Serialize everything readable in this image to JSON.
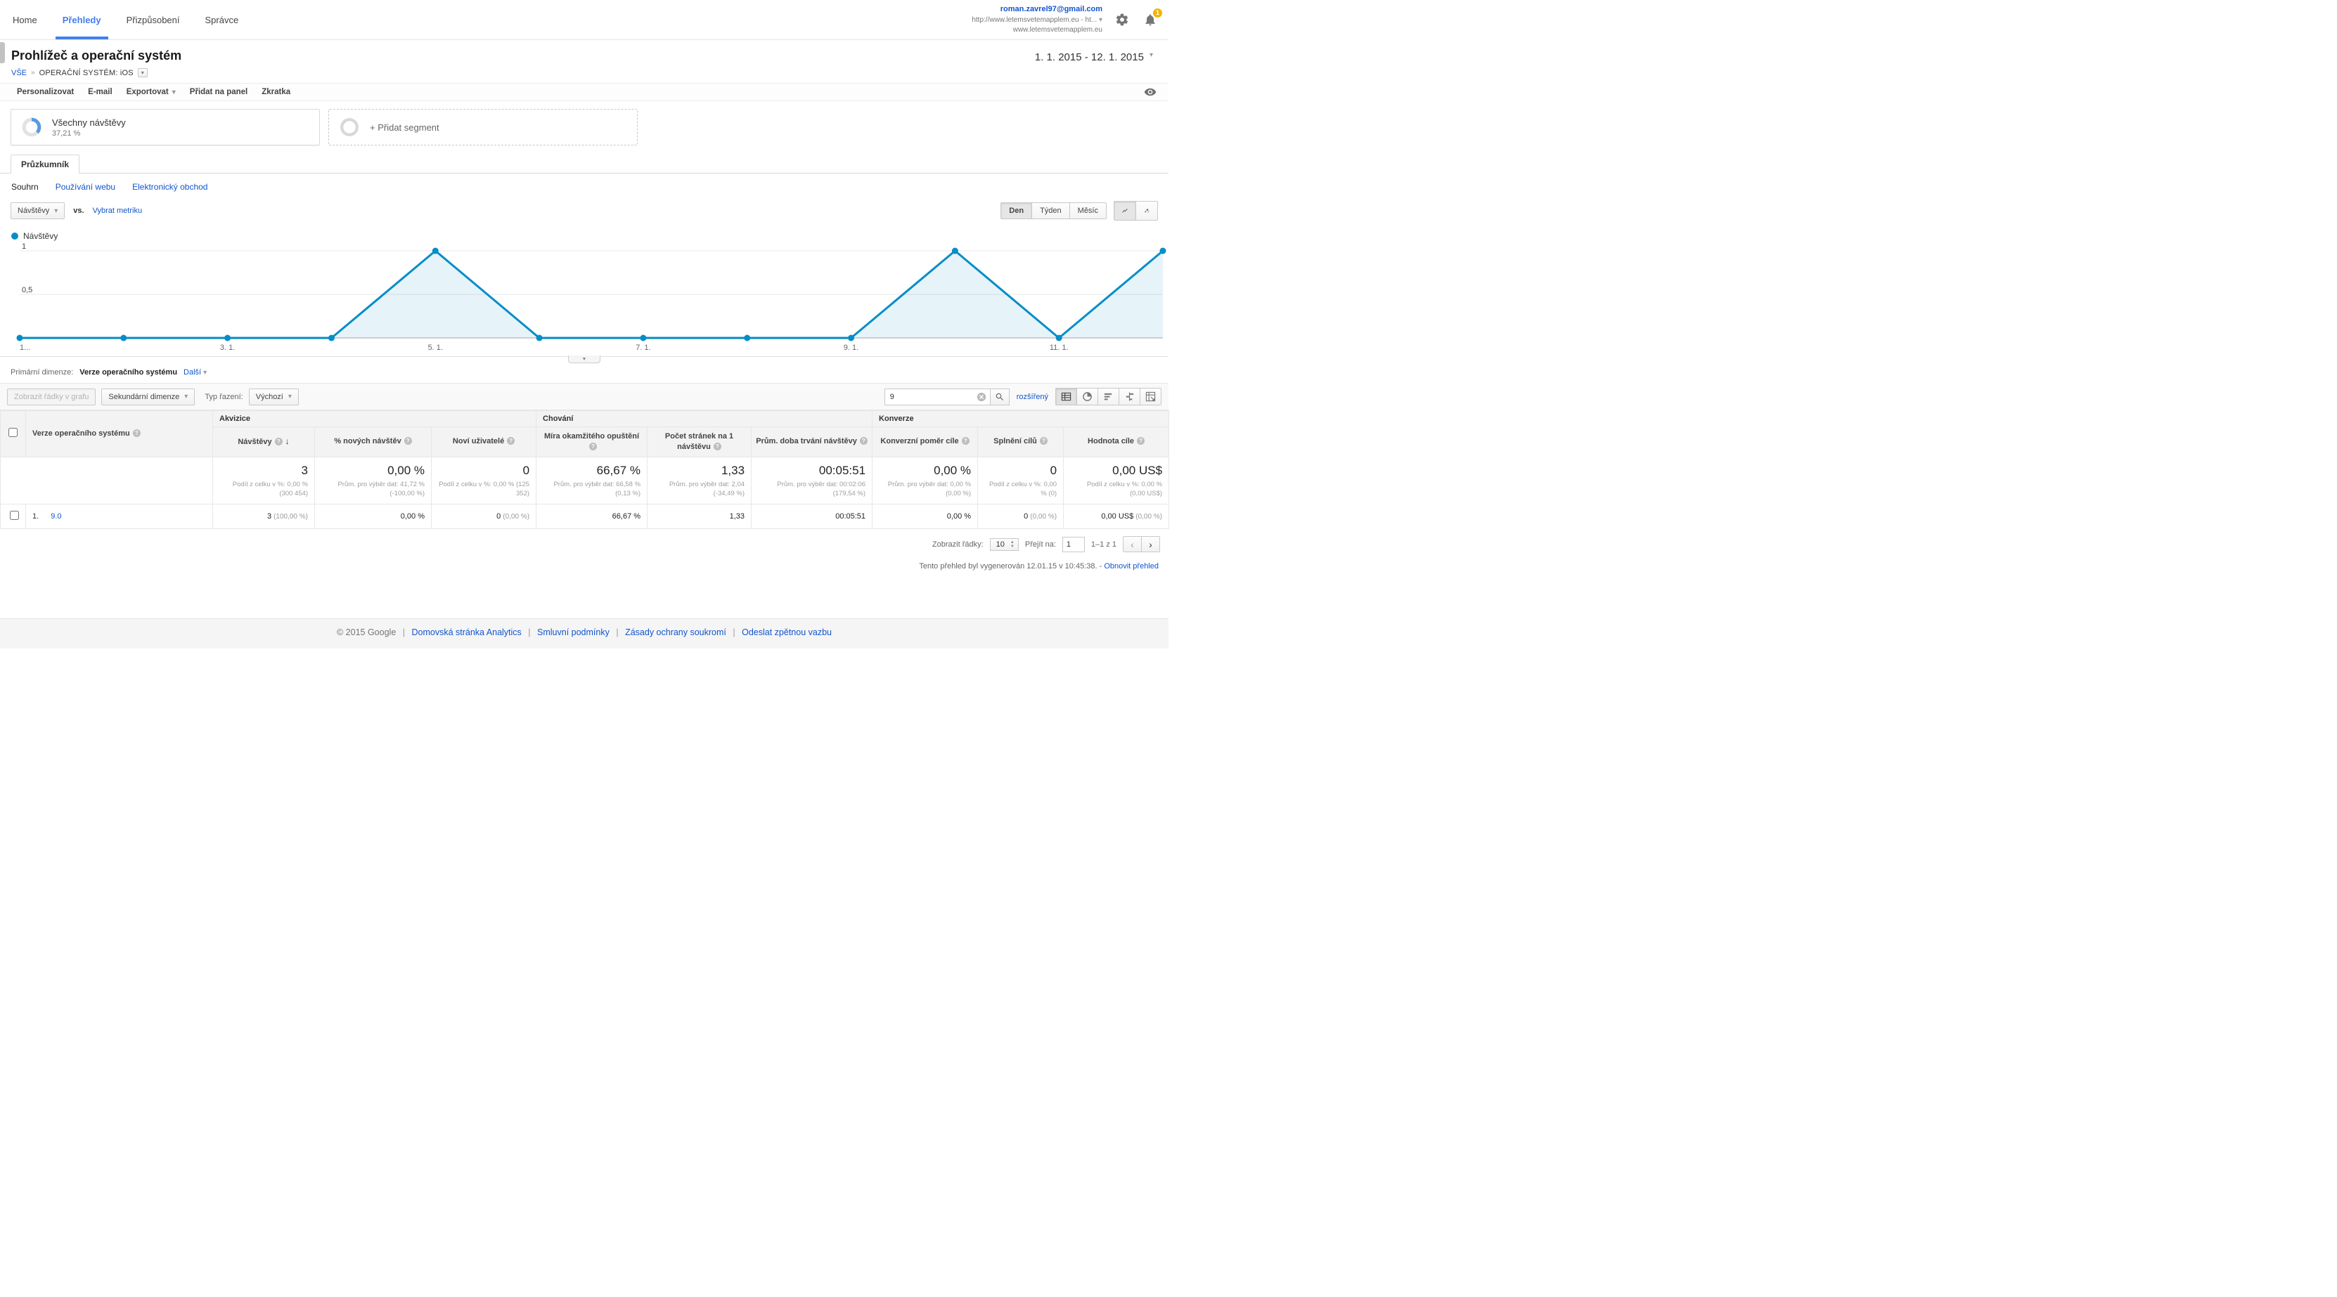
{
  "topnav": {
    "items": [
      {
        "label": "Home"
      },
      {
        "label": "Přehledy"
      },
      {
        "label": "Přizpůsobení"
      },
      {
        "label": "Správce"
      }
    ],
    "account_email": "roman.zavrel97@gmail.com",
    "account_line1": "http://www.letemsvetemapplem.eu - ht...",
    "account_line2": "www.letemsvetemapplem.eu",
    "notification_count": "1"
  },
  "header": {
    "title": "Prohlížeč a operační systém",
    "breadcrumb_all": "VŠE",
    "breadcrumb_segment": "OPERAČNÍ SYSTÉM: iOS",
    "date_range": "1. 1. 2015 - 12. 1. 2015"
  },
  "actionbar": {
    "items": [
      "Personalizovat",
      "E-mail",
      "Exportovat",
      "Přidat na panel",
      "Zkratka"
    ]
  },
  "segments": {
    "all_visits_label": "Všechny návštěvy",
    "all_visits_pct": "37,21 %",
    "add_segment": "+ Přidat segment"
  },
  "explorer": {
    "tab": "Průzkumník",
    "subtabs": [
      {
        "label": "Souhrn"
      },
      {
        "label": "Používání webu"
      },
      {
        "label": "Elektronický obchod"
      }
    ],
    "metric_select": "Návštěvy",
    "vs": "vs.",
    "select_metric": "Vybrat metriku",
    "granularity": [
      "Den",
      "Týden",
      "Měsíc"
    ],
    "legend": "Návštěvy"
  },
  "chart_data": {
    "type": "line",
    "title": "Návštěvy",
    "x": [
      "1. 1.",
      "2. 1.",
      "3. 1.",
      "4. 1.",
      "5. 1.",
      "6. 1.",
      "7. 1.",
      "8. 1.",
      "9. 1.",
      "10. 1.",
      "11. 1.",
      "12. 1."
    ],
    "series": [
      {
        "name": "Návštěvy",
        "values": [
          0,
          0,
          0,
          0,
          1,
          0,
          0,
          0,
          0,
          1,
          0,
          1
        ]
      }
    ],
    "ylim": [
      0,
      1
    ],
    "yticks": [
      "1",
      "0,5"
    ],
    "xtick_labels_visible": [
      "1...",
      "3. 1.",
      "5. 1.",
      "7. 1.",
      "9. 1.",
      "11. 1."
    ],
    "tick_positions": [
      0,
      2,
      4,
      6,
      8,
      10
    ],
    "line_color": "#058dc7",
    "fill_color": "rgba(5,141,199,0.10)",
    "grid": true,
    "legend_position": "top-left"
  },
  "dimension_bar": {
    "label": "Primární dimenze:",
    "selected": "Verze operačního systému",
    "more": "Další"
  },
  "table_toolbar": {
    "plot_rows": "Zobrazit řádky v grafu",
    "secondary_dimension": "Sekundární dimenze",
    "sort_type_label": "Typ řazení:",
    "sort_type_value": "Výchozí",
    "search_value": "9",
    "advanced": "rozšířený"
  },
  "table": {
    "groups": [
      "Akvizice",
      "Chování",
      "Konverze"
    ],
    "dimension_header": "Verze operačního systému",
    "columns": [
      "Návštěvy",
      "% nových návštěv",
      "Noví uživatelé",
      "Míra okamžitého opuštění",
      "Počet stránek na 1 návštěvu",
      "Prům. doba trvání návštěvy",
      "Konverzní poměr cíle",
      "Splnění cílů",
      "Hodnota cíle"
    ],
    "summary": {
      "visits": "3",
      "visits_sub": "Podíl z celku v %: 0,00 % (300 454)",
      "new_visits_pct": "0,00 %",
      "new_visits_sub": "Prům. pro výběr dat: 41,72 % (-100,00 %)",
      "new_users": "0",
      "new_users_sub": "Podíl z celku v %: 0,00 % (125 352)",
      "bounce": "66,67 %",
      "bounce_sub": "Prům. pro výběr dat: 66,58 % (0,13 %)",
      "pages": "1,33",
      "pages_sub": "Prům. pro výběr dat: 2,04 (-34,49 %)",
      "duration": "00:05:51",
      "duration_sub": "Prům. pro výběr dat: 00:02:06 (179,54 %)",
      "conv_rate": "0,00 %",
      "conv_rate_sub": "Prům. pro výběr dat: 0,00 % (0,00 %)",
      "completions": "0",
      "completions_sub": "Podíl z celku v %: 0,00 % (0)",
      "value": "0,00 US$",
      "value_sub": "Podíl z celku v %: 0,00 % (0,00 US$)"
    },
    "rows": [
      {
        "index": "1.",
        "dimension": "9.0",
        "visits": "3",
        "visits_pct": "(100,00 %)",
        "new_visits": "0,00 %",
        "new_users": "0",
        "new_users_pct": "(0,00 %)",
        "bounce": "66,67 %",
        "pages": "1,33",
        "duration": "00:05:51",
        "conv_rate": "0,00 %",
        "completions": "0",
        "completions_pct": "(0,00 %)",
        "value": "0,00 US$",
        "value_pct": "(0,00 %)"
      }
    ],
    "pagination": {
      "rows_label": "Zobrazit řádky:",
      "rows_value": "10",
      "goto_label": "Přejít na:",
      "goto_value": "1",
      "range": "1–1 z 1"
    }
  },
  "report_meta": {
    "generated": "Tento přehled byl vygenerován 12.01.15 v 10:45:38. -",
    "refresh": "Obnovit přehled"
  },
  "footer": {
    "copyright": "© 2015 Google",
    "links": [
      "Domovská stránka Analytics",
      "Smluvní podmínky",
      "Zásady ochrany soukromí",
      "Odeslat zpětnou vazbu"
    ]
  }
}
